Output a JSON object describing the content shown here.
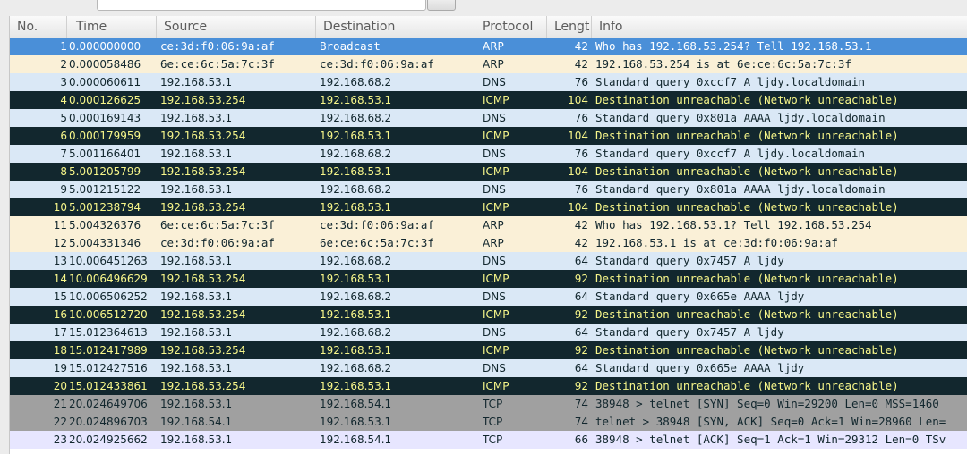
{
  "columns": {
    "no": "No.",
    "time": "Time",
    "source": "Source",
    "destination": "Destination",
    "protocol": "Protocol",
    "length": "Lengt",
    "info": "Info"
  },
  "colors": {
    "selected": {
      "bg": "#4a8fd8",
      "fg": "#ffffff"
    },
    "ARP": {
      "bg": "#faf0d7",
      "fg": "#12272e"
    },
    "DNS": {
      "bg": "#dae8f6",
      "fg": "#12272e"
    },
    "ICMP": {
      "bg": "#12272e",
      "fg": "#f7f68a"
    },
    "TCP_SYN": {
      "bg": "#a0a0a0",
      "fg": "#12272e"
    },
    "TCP": {
      "bg": "#e7e6ff",
      "fg": "#12272e"
    }
  },
  "packets": [
    {
      "no": "1",
      "time": "0.000000000",
      "source": "ce:3d:f0:06:9a:af",
      "destination": "Broadcast",
      "protocol": "ARP",
      "length": "42",
      "info": "Who has 192.168.53.254?  Tell 192.168.53.1",
      "style": "selected"
    },
    {
      "no": "2",
      "time": "0.000058486",
      "source": "6e:ce:6c:5a:7c:3f",
      "destination": "ce:3d:f0:06:9a:af",
      "protocol": "ARP",
      "length": "42",
      "info": "192.168.53.254 is at 6e:ce:6c:5a:7c:3f",
      "style": "ARP"
    },
    {
      "no": "3",
      "time": "0.000060611",
      "source": "192.168.53.1",
      "destination": "192.168.68.2",
      "protocol": "DNS",
      "length": "76",
      "info": "Standard query 0xccf7  A ljdy.localdomain",
      "style": "DNS"
    },
    {
      "no": "4",
      "time": "0.000126625",
      "source": "192.168.53.254",
      "destination": "192.168.53.1",
      "protocol": "ICMP",
      "length": "104",
      "info": "Destination unreachable (Network unreachable)",
      "style": "ICMP"
    },
    {
      "no": "5",
      "time": "0.000169143",
      "source": "192.168.53.1",
      "destination": "192.168.68.2",
      "protocol": "DNS",
      "length": "76",
      "info": "Standard query 0x801a  AAAA ljdy.localdomain",
      "style": "DNS"
    },
    {
      "no": "6",
      "time": "0.000179959",
      "source": "192.168.53.254",
      "destination": "192.168.53.1",
      "protocol": "ICMP",
      "length": "104",
      "info": "Destination unreachable (Network unreachable)",
      "style": "ICMP"
    },
    {
      "no": "7",
      "time": "5.001166401",
      "source": "192.168.53.1",
      "destination": "192.168.68.2",
      "protocol": "DNS",
      "length": "76",
      "info": "Standard query 0xccf7  A ljdy.localdomain",
      "style": "DNS"
    },
    {
      "no": "8",
      "time": "5.001205799",
      "source": "192.168.53.254",
      "destination": "192.168.53.1",
      "protocol": "ICMP",
      "length": "104",
      "info": "Destination unreachable (Network unreachable)",
      "style": "ICMP"
    },
    {
      "no": "9",
      "time": "5.001215122",
      "source": "192.168.53.1",
      "destination": "192.168.68.2",
      "protocol": "DNS",
      "length": "76",
      "info": "Standard query 0x801a  AAAA ljdy.localdomain",
      "style": "DNS"
    },
    {
      "no": "10",
      "time": "5.001238794",
      "source": "192.168.53.254",
      "destination": "192.168.53.1",
      "protocol": "ICMP",
      "length": "104",
      "info": "Destination unreachable (Network unreachable)",
      "style": "ICMP"
    },
    {
      "no": "11",
      "time": "5.004326376",
      "source": "6e:ce:6c:5a:7c:3f",
      "destination": "ce:3d:f0:06:9a:af",
      "protocol": "ARP",
      "length": "42",
      "info": "Who has 192.168.53.1?  Tell 192.168.53.254",
      "style": "ARP"
    },
    {
      "no": "12",
      "time": "5.004331346",
      "source": "ce:3d:f0:06:9a:af",
      "destination": "6e:ce:6c:5a:7c:3f",
      "protocol": "ARP",
      "length": "42",
      "info": "192.168.53.1 is at ce:3d:f0:06:9a:af",
      "style": "ARP"
    },
    {
      "no": "13",
      "time": "10.006451263",
      "source": "192.168.53.1",
      "destination": "192.168.68.2",
      "protocol": "DNS",
      "length": "64",
      "info": "Standard query 0x7457  A ljdy",
      "style": "DNS"
    },
    {
      "no": "14",
      "time": "10.006496629",
      "source": "192.168.53.254",
      "destination": "192.168.53.1",
      "protocol": "ICMP",
      "length": "92",
      "info": "Destination unreachable (Network unreachable)",
      "style": "ICMP"
    },
    {
      "no": "15",
      "time": "10.006506252",
      "source": "192.168.53.1",
      "destination": "192.168.68.2",
      "protocol": "DNS",
      "length": "64",
      "info": "Standard query 0x665e  AAAA ljdy",
      "style": "DNS"
    },
    {
      "no": "16",
      "time": "10.006512720",
      "source": "192.168.53.254",
      "destination": "192.168.53.1",
      "protocol": "ICMP",
      "length": "92",
      "info": "Destination unreachable (Network unreachable)",
      "style": "ICMP"
    },
    {
      "no": "17",
      "time": "15.012364613",
      "source": "192.168.53.1",
      "destination": "192.168.68.2",
      "protocol": "DNS",
      "length": "64",
      "info": "Standard query 0x7457  A ljdy",
      "style": "DNS"
    },
    {
      "no": "18",
      "time": "15.012417989",
      "source": "192.168.53.254",
      "destination": "192.168.53.1",
      "protocol": "ICMP",
      "length": "92",
      "info": "Destination unreachable (Network unreachable)",
      "style": "ICMP"
    },
    {
      "no": "19",
      "time": "15.012427516",
      "source": "192.168.53.1",
      "destination": "192.168.68.2",
      "protocol": "DNS",
      "length": "64",
      "info": "Standard query 0x665e  AAAA ljdy",
      "style": "DNS"
    },
    {
      "no": "20",
      "time": "15.012433861",
      "source": "192.168.53.254",
      "destination": "192.168.53.1",
      "protocol": "ICMP",
      "length": "92",
      "info": "Destination unreachable (Network unreachable)",
      "style": "ICMP"
    },
    {
      "no": "21",
      "time": "20.024649706",
      "source": "192.168.53.1",
      "destination": "192.168.54.1",
      "protocol": "TCP",
      "length": "74",
      "info": "38948 > telnet [SYN] Seq=0 Win=29200 Len=0 MSS=1460",
      "style": "TCP_SYN"
    },
    {
      "no": "22",
      "time": "20.024896703",
      "source": "192.168.54.1",
      "destination": "192.168.53.1",
      "protocol": "TCP",
      "length": "74",
      "info": "telnet > 38948 [SYN, ACK] Seq=0 Ack=1 Win=28960 Len=",
      "style": "TCP_SYN"
    },
    {
      "no": "23",
      "time": "20.024925662",
      "source": "192.168.53.1",
      "destination": "192.168.54.1",
      "protocol": "TCP",
      "length": "66",
      "info": "38948 > telnet [ACK] Seq=1 Ack=1 Win=29312 Len=0 TSv",
      "style": "TCP"
    }
  ]
}
